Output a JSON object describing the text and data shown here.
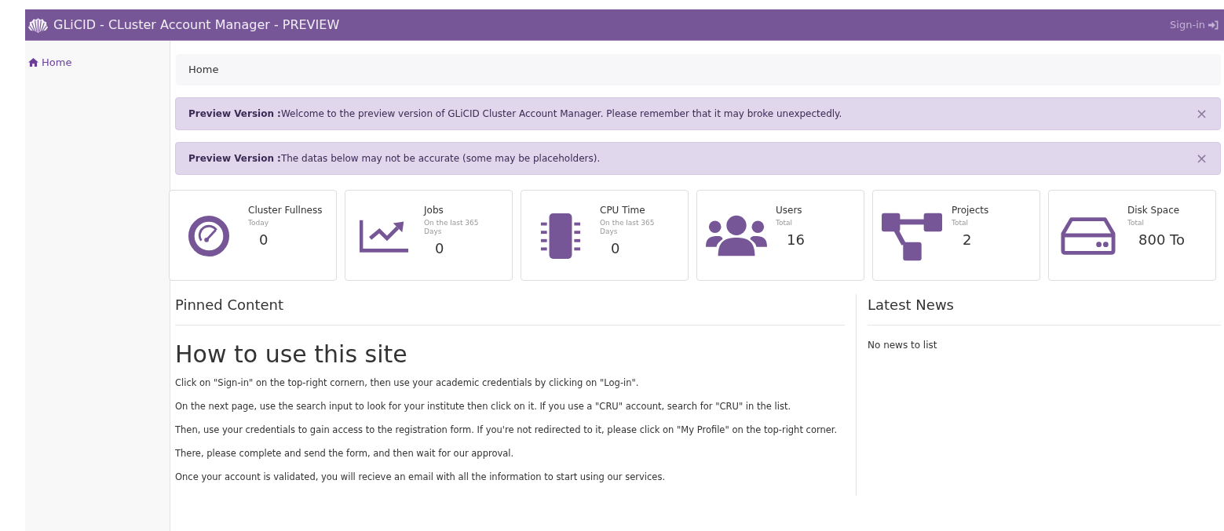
{
  "navbar": {
    "title": "GLiCID - CLuster Account Manager - PREVIEW",
    "signin": "Sign-in"
  },
  "sidebar": {
    "items": [
      {
        "label": "Home",
        "selected": true
      }
    ]
  },
  "breadcrumb": "Home",
  "alerts": [
    {
      "text": "**Preview Version :**Welcome to the preview version of GLiCID Cluster Account Manager. Please remember that it may broke unexpectedly.",
      "close": "×"
    },
    {
      "text": "**Preview Version :**The datas below may not be accurate (some may be placeholders).",
      "close": "×"
    }
  ],
  "stats": [
    {
      "kind": "gauge",
      "title": "Cluster Fullness",
      "subtitle": "Today",
      "value": "0"
    },
    {
      "kind": "chart",
      "title": "Jobs",
      "subtitle": "On the last 365 Days",
      "value": "0"
    },
    {
      "kind": "chip",
      "title": "CPU Time",
      "subtitle": "On the last 365 Days",
      "value": "0"
    },
    {
      "kind": "users",
      "title": "Users",
      "subtitle": "Total",
      "value": "16"
    },
    {
      "kind": "tree",
      "title": "Projects",
      "subtitle": "Total",
      "value": "2"
    },
    {
      "kind": "disk",
      "title": "Disk Space",
      "subtitle": "Total",
      "value": "800 To"
    }
  ],
  "pinned": {
    "heading": "Pinned Content",
    "title": "How to use this site",
    "paragraphs": [
      "Click on \"Sign-in\" on the top-right cornern, then use your academic credentials by clicking on \"Log-in\".",
      "On the next page, use the search input to look for your institute then click on it. If you use a \"CRU\" account, search for \"CRU\" in the list.",
      "Then, use your credentials to gain access to the registration form. If you're not redirected to it, please click on \"My Profile\" on the top-right corner.",
      "There, please complete and send the form, and then wait for our approval.",
      "Once your account is validated, you will recieve an email with all the information to start using our services."
    ]
  },
  "news": {
    "heading": "Latest News",
    "empty": "No news to list"
  }
}
